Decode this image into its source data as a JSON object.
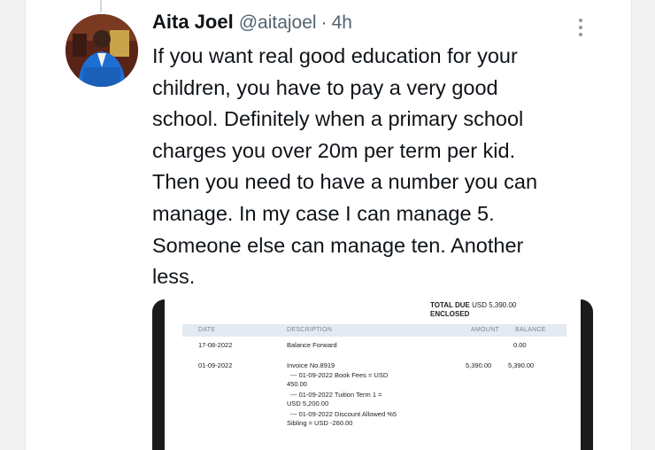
{
  "tweet": {
    "author_name": "Aita Joel",
    "handle": "@aitajoel",
    "separator": "·",
    "time": "4h",
    "text_lines": [
      "If you want real good education for your",
      "children, you have to pay a very good",
      "school. Definitely when a primary school",
      "charges you over 20m per term per kid.",
      "Then you need to have a number you can",
      "manage. In my case I can manage 5.",
      "Someone else can manage ten. Another",
      "less."
    ]
  },
  "icons": {
    "more": "more-options-icon",
    "avatar": "profile-photo"
  },
  "invoice": {
    "total_due_label": "TOTAL DUE",
    "total_due_value": "USD 5,390.00",
    "enclosed_label": "ENCLOSED",
    "headers": {
      "date": "DATE",
      "description": "DESCRIPTION",
      "amount": "AMOUNT",
      "balance": "BALANCE"
    },
    "rows": [
      {
        "date": "17-08-2022",
        "description": "Balance Forward",
        "amount": "",
        "balance": "0.00"
      },
      {
        "date": "01-09-2022",
        "description": "Invoice No.8919",
        "amount": "5,390.00",
        "balance": "5,390.00"
      }
    ],
    "detail_lines": [
      "--- 01-09-2022 Book Fees = USD",
      "450.00",
      "--- 01-09-2022 Tuition Term 1 =",
      "USD 5,200.00",
      "--- 01-09-2022 Discount Allowed %5",
      "Sibling = USD -260.00"
    ]
  },
  "colors": {
    "text": "#0f1419",
    "secondary": "#536471",
    "media_bg": "#1b1b1b",
    "table_header_bg": "#e3eaf2"
  }
}
